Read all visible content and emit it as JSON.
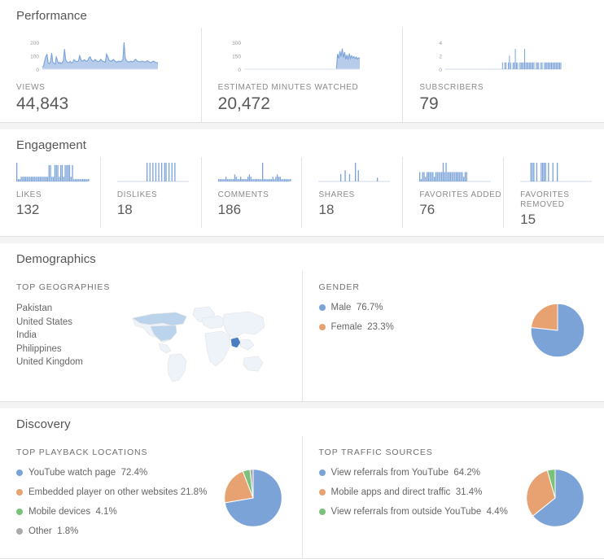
{
  "colors": {
    "blue": "#7ba3d8",
    "orange": "#e8a272",
    "green": "#7bc17b",
    "gray": "#aaaaaa",
    "map_light": "#eef3fa",
    "map_mid": "#bcd3ec",
    "map_dark": "#4a7fc1",
    "map_outline": "#e2e2e2"
  },
  "performance": {
    "title": "Performance",
    "cards": [
      {
        "label": "VIEWS",
        "value": "44,843",
        "ticks": [
          "200",
          "100",
          "0"
        ]
      },
      {
        "label": "ESTIMATED MINUTES WATCHED",
        "value": "20,472",
        "ticks": [
          "300",
          "150",
          "0"
        ]
      },
      {
        "label": "SUBSCRIBERS",
        "value": "79",
        "ticks": [
          "4",
          "2",
          "0"
        ]
      }
    ]
  },
  "engagement": {
    "title": "Engagement",
    "cards": [
      {
        "label": "LIKES",
        "value": "132"
      },
      {
        "label": "DISLIKES",
        "value": "18"
      },
      {
        "label": "COMMENTS",
        "value": "186"
      },
      {
        "label": "SHARES",
        "value": "18"
      },
      {
        "label": "FAVORITES ADDED",
        "value": "76"
      },
      {
        "label": "FAVORITES REMOVED",
        "value": "15"
      }
    ]
  },
  "demographics": {
    "title": "Demographics",
    "geographies": {
      "title": "TOP GEOGRAPHIES",
      "items": [
        "Pakistan",
        "United States",
        "India",
        "Philippines",
        "United Kingdom"
      ]
    },
    "gender": {
      "title": "GENDER",
      "items": [
        {
          "label": "Male",
          "percent": "76.7%",
          "color": "#7ba3d8"
        },
        {
          "label": "Female",
          "percent": "23.3%",
          "color": "#e8a272"
        }
      ]
    }
  },
  "discovery": {
    "title": "Discovery",
    "playback": {
      "title": "TOP PLAYBACK LOCATIONS",
      "items": [
        {
          "label": "YouTube watch page",
          "percent": "72.4%",
          "color": "#7ba3d8"
        },
        {
          "label": "Embedded player on other websites",
          "percent": "21.8%",
          "color": "#e8a272"
        },
        {
          "label": "Mobile devices",
          "percent": "4.1%",
          "color": "#7bc17b"
        },
        {
          "label": "Other",
          "percent": "1.8%",
          "color": "#aaaaaa"
        }
      ]
    },
    "traffic": {
      "title": "TOP TRAFFIC SOURCES",
      "items": [
        {
          "label": "View referrals from YouTube",
          "percent": "64.2%",
          "color": "#7ba3d8"
        },
        {
          "label": "Mobile apps and direct traffic",
          "percent": "31.4%",
          "color": "#e8a272"
        },
        {
          "label": "View referrals from outside YouTube",
          "percent": "4.4%",
          "color": "#7bc17b"
        }
      ]
    }
  },
  "chart_data": [
    {
      "type": "area",
      "title": "Views",
      "ylabel": "Views",
      "ylim": [
        0,
        200
      ],
      "yticks": [
        0,
        100,
        200
      ],
      "total": 44843,
      "values": [
        18,
        22,
        60,
        95,
        110,
        48,
        40,
        55,
        120,
        52,
        42,
        38,
        95,
        60,
        44,
        50,
        42,
        48,
        62,
        150,
        70,
        55,
        48,
        52,
        58,
        46,
        50,
        70,
        64,
        58,
        56,
        62,
        100,
        74,
        58,
        64,
        70,
        62,
        58,
        66,
        86,
        92,
        70,
        62,
        58,
        72,
        66,
        58,
        56,
        60,
        74,
        64,
        58,
        55,
        52,
        112,
        96,
        70,
        62,
        58,
        66,
        72,
        62,
        56,
        52,
        60,
        58,
        56,
        62,
        70,
        200,
        86,
        64,
        58,
        52,
        56,
        60,
        54,
        58,
        66,
        74,
        62,
        58,
        56,
        54,
        60,
        58,
        56,
        52,
        58,
        64,
        56,
        52,
        48,
        54,
        60,
        56,
        50,
        46,
        52
      ]
    },
    {
      "type": "area",
      "title": "Estimated minutes watched",
      "ylabel": "Minutes",
      "ylim": [
        0,
        300
      ],
      "yticks": [
        0,
        150,
        300
      ],
      "total": 20472,
      "values": [
        0,
        0,
        0,
        0,
        0,
        0,
        0,
        0,
        0,
        0,
        0,
        0,
        0,
        0,
        0,
        0,
        0,
        0,
        0,
        0,
        0,
        0,
        0,
        0,
        0,
        0,
        0,
        0,
        0,
        0,
        0,
        0,
        0,
        0,
        0,
        0,
        0,
        0,
        0,
        0,
        0,
        0,
        0,
        0,
        0,
        0,
        0,
        0,
        0,
        0,
        0,
        0,
        0,
        0,
        0,
        0,
        0,
        0,
        0,
        0,
        0,
        0,
        0,
        0,
        0,
        0,
        0,
        0,
        0,
        0,
        0,
        0,
        0,
        0,
        0,
        0,
        0,
        0,
        0,
        0,
        170,
        120,
        200,
        140,
        230,
        130,
        190,
        110,
        160,
        105,
        175,
        120,
        150,
        125,
        140,
        118,
        135,
        112,
        128,
        120
      ]
    },
    {
      "type": "bar",
      "title": "Subscribers",
      "ylabel": "Subscribers",
      "ylim": [
        0,
        4
      ],
      "yticks": [
        0,
        2,
        4
      ],
      "total": 79,
      "values": [
        0,
        0,
        0,
        0,
        0,
        0,
        0,
        0,
        0,
        0,
        0,
        0,
        0,
        0,
        0,
        0,
        0,
        0,
        0,
        0,
        0,
        0,
        0,
        0,
        0,
        0,
        0,
        0,
        0,
        0,
        0,
        0,
        0,
        0,
        0,
        0,
        0,
        0,
        0,
        0,
        0,
        0,
        0,
        0,
        0,
        0,
        0,
        0,
        0,
        1,
        0,
        1,
        1,
        0,
        1,
        2,
        1,
        0,
        1,
        1,
        3,
        1,
        1,
        0,
        1,
        1,
        1,
        1,
        3,
        1,
        1,
        1,
        1,
        1,
        1,
        1,
        1,
        0,
        1,
        1,
        1,
        0,
        1,
        1,
        0,
        1,
        1,
        1,
        1,
        1,
        1,
        1,
        1,
        1,
        1,
        1,
        1,
        1,
        1,
        1
      ]
    },
    {
      "type": "bar",
      "title": "Likes",
      "total": 132,
      "values": [
        8,
        1,
        1,
        2,
        2,
        2,
        2,
        2,
        2,
        2,
        2,
        2,
        2,
        2,
        2,
        2,
        2,
        2,
        2,
        2,
        2,
        2,
        7,
        7,
        2,
        2,
        7,
        7,
        7,
        2,
        7,
        7,
        2,
        7,
        7,
        7,
        7,
        2,
        7,
        1,
        1,
        1,
        1,
        1,
        1,
        1,
        1,
        1,
        1,
        1
      ]
    },
    {
      "type": "bar",
      "title": "Dislikes",
      "total": 18,
      "values": [
        0,
        0,
        0,
        0,
        0,
        0,
        0,
        0,
        0,
        0,
        0,
        0,
        0,
        0,
        0,
        0,
        0,
        0,
        0,
        0,
        6,
        0,
        6,
        0,
        6,
        0,
        6,
        0,
        6,
        0,
        6,
        0,
        6,
        6,
        0,
        6,
        0,
        6,
        0,
        6,
        0,
        0,
        0,
        0,
        0,
        0,
        0,
        0,
        0,
        0
      ]
    },
    {
      "type": "bar",
      "title": "Comments",
      "total": 186,
      "values": [
        1,
        1,
        1,
        1,
        1,
        2,
        1,
        1,
        1,
        1,
        1,
        3,
        2,
        1,
        1,
        2,
        1,
        1,
        1,
        1,
        2,
        3,
        2,
        1,
        1,
        1,
        1,
        1,
        1,
        1,
        8,
        1,
        1,
        1,
        1,
        1,
        1,
        2,
        1,
        2,
        3,
        2,
        2,
        1,
        1,
        1,
        1,
        1,
        1,
        1
      ]
    },
    {
      "type": "bar",
      "title": "Shares",
      "total": 18,
      "values": [
        0,
        0,
        0,
        0,
        0,
        0,
        0,
        0,
        0,
        0,
        0,
        0,
        0,
        0,
        0,
        2,
        0,
        0,
        3,
        0,
        0,
        2,
        0,
        0,
        0,
        5,
        0,
        3,
        0,
        0,
        0,
        0,
        0,
        0,
        0,
        0,
        0,
        0,
        0,
        0,
        1,
        0,
        0,
        0,
        0,
        0,
        0,
        0,
        0,
        0
      ]
    },
    {
      "type": "bar",
      "title": "Favorites added",
      "total": 76,
      "values": [
        4,
        1,
        4,
        4,
        2,
        4,
        4,
        4,
        4,
        4,
        2,
        4,
        4,
        4,
        4,
        4,
        8,
        4,
        8,
        4,
        4,
        4,
        4,
        4,
        4,
        4,
        4,
        4,
        4,
        4,
        2,
        4,
        4,
        0,
        0,
        0,
        0,
        0,
        0,
        0,
        0,
        0,
        0,
        0,
        0,
        0,
        0,
        0,
        0,
        0
      ]
    },
    {
      "type": "bar",
      "title": "Favorites removed",
      "total": 15,
      "values": [
        0,
        0,
        0,
        0,
        0,
        0,
        0,
        4,
        4,
        4,
        0,
        4,
        0,
        0,
        4,
        4,
        4,
        4,
        0,
        4,
        0,
        0,
        4,
        0,
        0,
        4,
        0,
        0,
        0,
        0,
        0,
        0,
        0,
        0,
        0,
        0,
        0,
        0,
        0,
        0,
        0,
        0,
        0,
        0,
        0,
        0,
        0,
        0,
        0,
        0
      ]
    },
    {
      "type": "pie",
      "title": "Gender",
      "labels": [
        "Male",
        "Female"
      ],
      "values": [
        76.7,
        23.3
      ],
      "colors": [
        "#7ba3d8",
        "#e8a272"
      ],
      "legend": "left"
    },
    {
      "type": "pie",
      "title": "Top playback locations",
      "labels": [
        "YouTube watch page",
        "Embedded player on other websites",
        "Mobile devices",
        "Other"
      ],
      "values": [
        72.4,
        21.8,
        4.1,
        1.8
      ],
      "colors": [
        "#7ba3d8",
        "#e8a272",
        "#7bc17b",
        "#aaaaaa"
      ],
      "legend": "left"
    },
    {
      "type": "pie",
      "title": "Top traffic sources",
      "labels": [
        "View referrals from YouTube",
        "Mobile apps and direct traffic",
        "View referrals from outside YouTube"
      ],
      "values": [
        64.2,
        31.4,
        4.4
      ],
      "colors": [
        "#7ba3d8",
        "#e8a272",
        "#7bc17b"
      ],
      "legend": "left"
    }
  ]
}
